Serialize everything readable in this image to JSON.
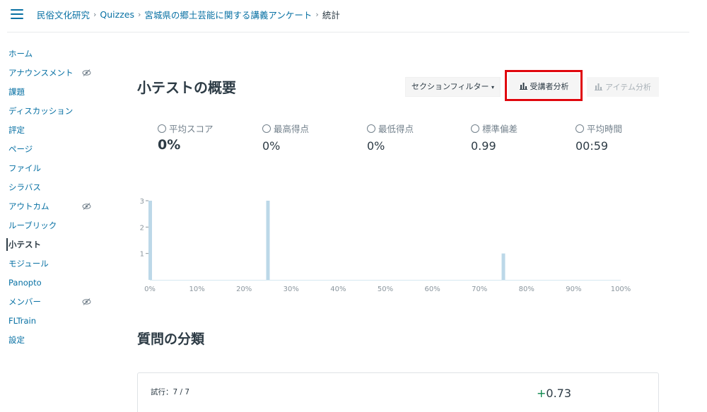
{
  "breadcrumbs": [
    {
      "label": "民俗文化研究"
    },
    {
      "label": "Quizzes"
    },
    {
      "label": "宮城県の郷土芸能に関する講義アンケート"
    },
    {
      "label": "統計"
    }
  ],
  "sidebar": {
    "items": [
      {
        "label": "ホーム",
        "hidden": false
      },
      {
        "label": "アナウンスメント",
        "hidden": true
      },
      {
        "label": "課題",
        "hidden": false
      },
      {
        "label": "ディスカッション",
        "hidden": false
      },
      {
        "label": "評定",
        "hidden": false
      },
      {
        "label": "ページ",
        "hidden": false
      },
      {
        "label": "ファイル",
        "hidden": false
      },
      {
        "label": "シラバス",
        "hidden": false
      },
      {
        "label": "アウトカム",
        "hidden": true
      },
      {
        "label": "ルーブリック",
        "hidden": false
      },
      {
        "label": "小テスト",
        "hidden": false,
        "active": true
      },
      {
        "label": "モジュール",
        "hidden": false
      },
      {
        "label": "Panopto",
        "hidden": false
      },
      {
        "label": "メンバー",
        "hidden": true
      },
      {
        "label": "FLTrain",
        "hidden": false
      },
      {
        "label": "設定",
        "hidden": false
      }
    ]
  },
  "summary": {
    "title": "小テストの概要",
    "section_filter": "セクションフィルター",
    "student_analysis": "受講者分析",
    "item_analysis": "アイテム分析"
  },
  "stats": [
    {
      "label": "平均スコア",
      "value": "0%",
      "icon": "score-icon"
    },
    {
      "label": "最高得点",
      "value": "0%",
      "icon": "arrow-up-right-icon"
    },
    {
      "label": "最低得点",
      "value": "0%",
      "icon": "arrow-down-right-icon"
    },
    {
      "label": "標準偏差",
      "value": "0.99",
      "icon": "sigma-icon"
    },
    {
      "label": "平均時間",
      "value": "00:59",
      "icon": "clock-icon"
    }
  ],
  "chart_data": {
    "type": "bar",
    "x": [
      0,
      25,
      75
    ],
    "values": [
      3,
      3,
      1
    ],
    "xlim": [
      0,
      100
    ],
    "ylim": [
      0,
      3
    ],
    "xticks": [
      "0%",
      "10%",
      "20%",
      "30%",
      "40%",
      "50%",
      "60%",
      "70%",
      "80%",
      "90%",
      "100%"
    ],
    "yticks": [
      "1",
      "2",
      "3"
    ],
    "bar_color": "#bcd8e8"
  },
  "questions": {
    "title": "質問の分類",
    "attempts": "試行：7 / 7",
    "score_sign": "+",
    "score": "0.73"
  }
}
